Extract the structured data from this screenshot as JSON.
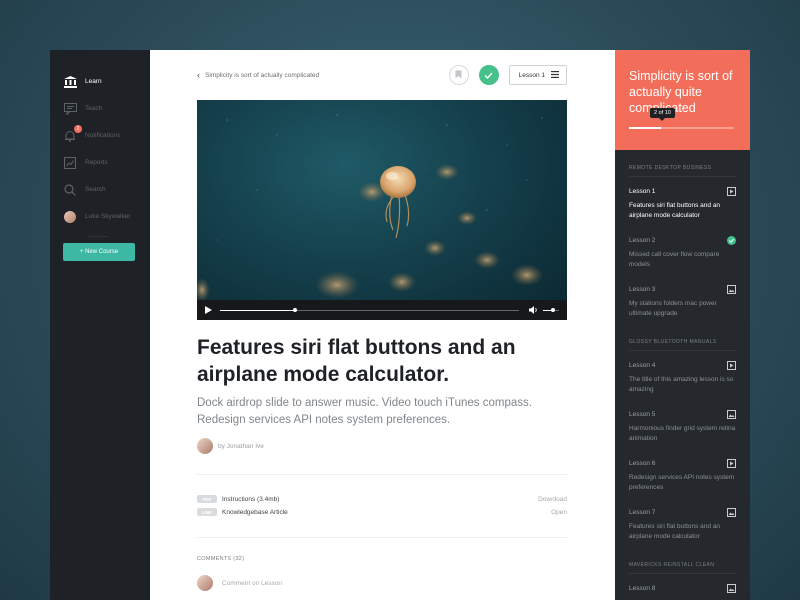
{
  "sidebar": {
    "items": [
      {
        "label": "Learn",
        "icon": "bank-icon",
        "active": true
      },
      {
        "label": "Teach",
        "icon": "chat-icon",
        "active": false
      },
      {
        "label": "Notifications",
        "icon": "bell-icon",
        "active": false,
        "badge": "2"
      },
      {
        "label": "Reports",
        "icon": "chart-icon",
        "active": false
      },
      {
        "label": "Search",
        "icon": "search-icon",
        "active": false
      },
      {
        "label": "Luke Skywalker",
        "icon": "avatar",
        "active": false
      }
    ],
    "new_course_label": "+ New Course"
  },
  "header": {
    "back_label": "Simplicity is sort of actually complicated",
    "lesson_button": "Lesson 1"
  },
  "video": {
    "progress": 0.25,
    "volume": 0.6
  },
  "content": {
    "title": "Features siri flat buttons and an airplane mode calculator.",
    "subtitle": "Dock airdrop slide to answer music. Video touch iTunes compass. Redesign services API notes system preferences.",
    "author": "by Jonathan Ive",
    "attachments": [
      {
        "tag": "PDF",
        "name": "Instructions (3.4mb)",
        "action": "Download"
      },
      {
        "tag": "LINK",
        "name": "Knowledgebase Article",
        "action": "Open"
      }
    ],
    "comments_heading": "COMMENTS (32)",
    "comment_placeholder": "Comment on Lesson"
  },
  "course_panel": {
    "title": "Simplicity is sort of actually quite complicated",
    "progress_label": "2 of 10",
    "progress": 0.3,
    "colors": {
      "accent": "#f26e5b",
      "success": "#46c18b",
      "teal": "#3cb8a5"
    },
    "sections": [
      {
        "heading": "REMOTE DESKTOP BUSINESS",
        "lessons": [
          {
            "name": "Lesson 1",
            "desc": "Features siri flat buttons and an airplane mode calculator",
            "icon": "video-icon",
            "active": true
          },
          {
            "name": "Lesson 2",
            "desc": "Missed call cover flow compare models",
            "icon": "check-icon",
            "active": false
          },
          {
            "name": "Lesson 3",
            "desc": "My stations folders mac power ultimate upgrade",
            "icon": "image-icon",
            "active": false
          }
        ]
      },
      {
        "heading": "GLOSSY BLUETOOTH MANUALS",
        "lessons": [
          {
            "name": "Lesson 4",
            "desc": "The title of this amazing lesson is so amazing",
            "icon": "video-icon",
            "active": false
          },
          {
            "name": "Lesson 5",
            "desc": "Harmonious finder grid system retina animation",
            "icon": "image-icon",
            "active": false
          },
          {
            "name": "Lesson 6",
            "desc": "Redesign services API notes system preferences",
            "icon": "video-icon",
            "active": false
          },
          {
            "name": "Lesson 7",
            "desc": "Features siri flat buttons and an airplane mode calculator",
            "icon": "image-icon",
            "active": false
          }
        ]
      },
      {
        "heading": "MAVERICKS REINSTALL CLEAN",
        "lessons": [
          {
            "name": "Lesson 8",
            "desc": "",
            "icon": "image-icon",
            "active": false
          }
        ]
      }
    ]
  }
}
